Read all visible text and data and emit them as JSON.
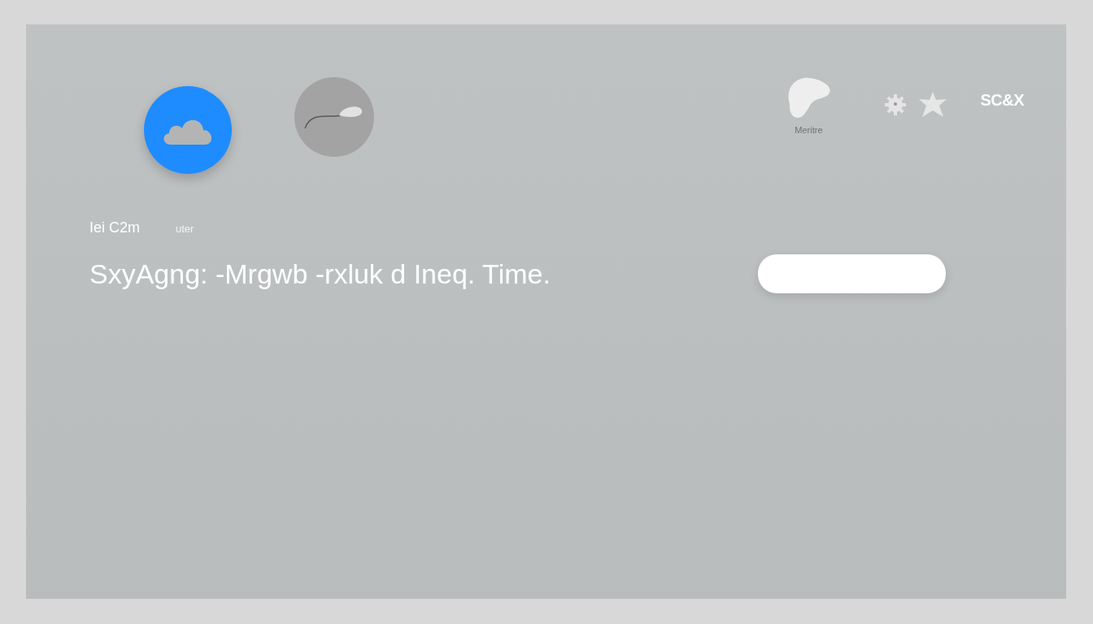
{
  "toggles": [
    {
      "kind": "cloud",
      "selected": true
    },
    {
      "kind": "wave",
      "selected": false
    }
  ],
  "top_right": {
    "blob_label": "Meritre",
    "logo_text": "SC&X"
  },
  "caption": {
    "label": "Iei C2m",
    "hint": "uter"
  },
  "headline": "SxyAgng: -Mrgwb -rxluk d Ineq. Time.",
  "search": {
    "kind": "field"
  }
}
